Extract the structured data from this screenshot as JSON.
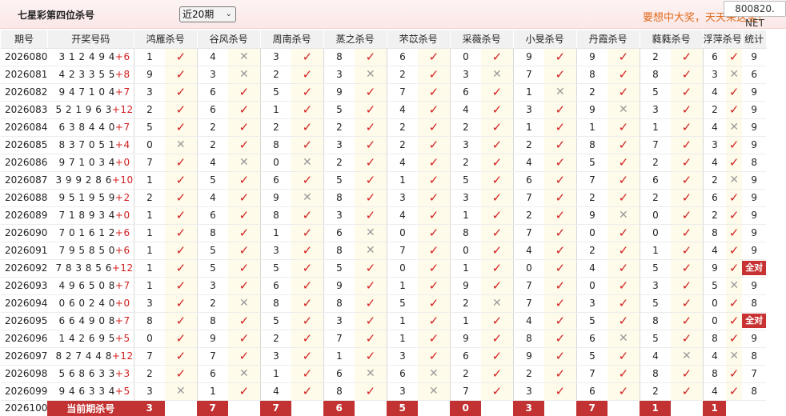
{
  "header": {
    "title": "七星彩第四位杀号",
    "period_selected": "近20期",
    "slogan": "要想中大奖，天天来这里！",
    "brand": "800820. NET"
  },
  "columns": [
    "期号",
    "开奖号码",
    "鸿雁杀号",
    "谷风杀号",
    "周南杀号",
    "蒸之杀号",
    "芣苡杀号",
    "采薇杀号",
    "小旻杀号",
    "丹霞杀号",
    "蕤蕤杀号",
    "浮萍杀号",
    "统计"
  ],
  "rows": [
    {
      "period": "2026080",
      "draw": "3 1 2 4 9 4",
      "sum": "+6",
      "picks": [
        [
          1,
          "ok"
        ],
        [
          4,
          "x"
        ],
        [
          3,
          "ok"
        ],
        [
          8,
          "ok"
        ],
        [
          6,
          "ok"
        ],
        [
          0,
          "ok"
        ],
        [
          9,
          "ok"
        ],
        [
          9,
          "ok"
        ],
        [
          2,
          "ok"
        ],
        [
          6,
          "ok"
        ]
      ],
      "stat": "9"
    },
    {
      "period": "2026081",
      "draw": "4 2 3 3 5 5",
      "sum": "+8",
      "picks": [
        [
          9,
          "ok"
        ],
        [
          3,
          "x"
        ],
        [
          2,
          "ok"
        ],
        [
          3,
          "x"
        ],
        [
          2,
          "ok"
        ],
        [
          3,
          "x"
        ],
        [
          7,
          "ok"
        ],
        [
          8,
          "ok"
        ],
        [
          8,
          "ok"
        ],
        [
          3,
          "x"
        ]
      ],
      "stat": "6"
    },
    {
      "period": "2026082",
      "draw": "9 4 7 1 0 4",
      "sum": "+7",
      "picks": [
        [
          3,
          "ok"
        ],
        [
          6,
          "ok"
        ],
        [
          5,
          "ok"
        ],
        [
          9,
          "ok"
        ],
        [
          7,
          "ok"
        ],
        [
          6,
          "ok"
        ],
        [
          1,
          "x"
        ],
        [
          2,
          "ok"
        ],
        [
          5,
          "ok"
        ],
        [
          4,
          "ok"
        ]
      ],
      "stat": "9"
    },
    {
      "period": "2026083",
      "draw": "5 2 1 9 6 3",
      "sum": "+12",
      "picks": [
        [
          2,
          "ok"
        ],
        [
          6,
          "ok"
        ],
        [
          1,
          "ok"
        ],
        [
          5,
          "ok"
        ],
        [
          4,
          "ok"
        ],
        [
          4,
          "ok"
        ],
        [
          3,
          "ok"
        ],
        [
          9,
          "x"
        ],
        [
          3,
          "ok"
        ],
        [
          2,
          "ok"
        ]
      ],
      "stat": "9"
    },
    {
      "period": "2026084",
      "draw": "6 3 8 4 4 0",
      "sum": "+7",
      "picks": [
        [
          5,
          "ok"
        ],
        [
          2,
          "ok"
        ],
        [
          2,
          "ok"
        ],
        [
          2,
          "ok"
        ],
        [
          2,
          "ok"
        ],
        [
          2,
          "ok"
        ],
        [
          1,
          "ok"
        ],
        [
          1,
          "ok"
        ],
        [
          1,
          "ok"
        ],
        [
          4,
          "x"
        ]
      ],
      "stat": "9"
    },
    {
      "period": "2026085",
      "draw": "8 3 7 0 5 1",
      "sum": "+4",
      "picks": [
        [
          0,
          "x"
        ],
        [
          2,
          "ok"
        ],
        [
          8,
          "ok"
        ],
        [
          3,
          "ok"
        ],
        [
          2,
          "ok"
        ],
        [
          3,
          "ok"
        ],
        [
          2,
          "ok"
        ],
        [
          8,
          "ok"
        ],
        [
          7,
          "ok"
        ],
        [
          3,
          "ok"
        ]
      ],
      "stat": "9"
    },
    {
      "period": "2026086",
      "draw": "9 7 1 0 3 4",
      "sum": "+0",
      "picks": [
        [
          7,
          "ok"
        ],
        [
          4,
          "x"
        ],
        [
          0,
          "x"
        ],
        [
          2,
          "ok"
        ],
        [
          4,
          "ok"
        ],
        [
          2,
          "ok"
        ],
        [
          4,
          "ok"
        ],
        [
          5,
          "ok"
        ],
        [
          2,
          "ok"
        ],
        [
          4,
          "ok"
        ]
      ],
      "stat": "8"
    },
    {
      "period": "2026087",
      "draw": "3 9 9 2 8 6",
      "sum": "+10",
      "picks": [
        [
          1,
          "ok"
        ],
        [
          5,
          "ok"
        ],
        [
          6,
          "ok"
        ],
        [
          5,
          "ok"
        ],
        [
          1,
          "ok"
        ],
        [
          5,
          "ok"
        ],
        [
          6,
          "ok"
        ],
        [
          7,
          "ok"
        ],
        [
          6,
          "ok"
        ],
        [
          2,
          "x"
        ]
      ],
      "stat": "9"
    },
    {
      "period": "2026088",
      "draw": "9 5 1 9 5 9",
      "sum": "+2",
      "picks": [
        [
          2,
          "ok"
        ],
        [
          4,
          "ok"
        ],
        [
          9,
          "x"
        ],
        [
          8,
          "ok"
        ],
        [
          3,
          "ok"
        ],
        [
          3,
          "ok"
        ],
        [
          7,
          "ok"
        ],
        [
          2,
          "ok"
        ],
        [
          2,
          "ok"
        ],
        [
          6,
          "ok"
        ]
      ],
      "stat": "9"
    },
    {
      "period": "2026089",
      "draw": "7 1 8 9 3 4",
      "sum": "+0",
      "picks": [
        [
          1,
          "ok"
        ],
        [
          6,
          "ok"
        ],
        [
          8,
          "ok"
        ],
        [
          3,
          "ok"
        ],
        [
          4,
          "ok"
        ],
        [
          1,
          "ok"
        ],
        [
          2,
          "ok"
        ],
        [
          9,
          "x"
        ],
        [
          0,
          "ok"
        ],
        [
          2,
          "ok"
        ]
      ],
      "stat": "9"
    },
    {
      "period": "2026090",
      "draw": "7 0 1 6 1 2",
      "sum": "+6",
      "picks": [
        [
          1,
          "ok"
        ],
        [
          8,
          "ok"
        ],
        [
          1,
          "ok"
        ],
        [
          6,
          "x"
        ],
        [
          0,
          "ok"
        ],
        [
          8,
          "ok"
        ],
        [
          7,
          "ok"
        ],
        [
          0,
          "ok"
        ],
        [
          0,
          "ok"
        ],
        [
          8,
          "ok"
        ]
      ],
      "stat": "9"
    },
    {
      "period": "2026091",
      "draw": "7 9 5 8 5 0",
      "sum": "+6",
      "picks": [
        [
          1,
          "ok"
        ],
        [
          5,
          "ok"
        ],
        [
          3,
          "ok"
        ],
        [
          8,
          "x"
        ],
        [
          7,
          "ok"
        ],
        [
          0,
          "ok"
        ],
        [
          4,
          "ok"
        ],
        [
          2,
          "ok"
        ],
        [
          1,
          "ok"
        ],
        [
          4,
          "ok"
        ]
      ],
      "stat": "9"
    },
    {
      "period": "2026092",
      "draw": "7 8 3 8 5 6",
      "sum": "+12",
      "picks": [
        [
          1,
          "ok"
        ],
        [
          5,
          "ok"
        ],
        [
          5,
          "ok"
        ],
        [
          5,
          "ok"
        ],
        [
          0,
          "ok"
        ],
        [
          1,
          "ok"
        ],
        [
          0,
          "ok"
        ],
        [
          4,
          "ok"
        ],
        [
          5,
          "ok"
        ],
        [
          9,
          "ok"
        ]
      ],
      "stat": "全对"
    },
    {
      "period": "2026093",
      "draw": "4 9 6 5 0 8",
      "sum": "+7",
      "picks": [
        [
          1,
          "ok"
        ],
        [
          3,
          "ok"
        ],
        [
          6,
          "ok"
        ],
        [
          9,
          "ok"
        ],
        [
          1,
          "ok"
        ],
        [
          9,
          "ok"
        ],
        [
          7,
          "ok"
        ],
        [
          0,
          "ok"
        ],
        [
          3,
          "ok"
        ],
        [
          5,
          "x"
        ]
      ],
      "stat": "9"
    },
    {
      "period": "2026094",
      "draw": "0 6 0 2 4 0",
      "sum": "+0",
      "picks": [
        [
          3,
          "ok"
        ],
        [
          2,
          "x"
        ],
        [
          8,
          "ok"
        ],
        [
          8,
          "ok"
        ],
        [
          5,
          "ok"
        ],
        [
          2,
          "x"
        ],
        [
          7,
          "ok"
        ],
        [
          3,
          "ok"
        ],
        [
          5,
          "ok"
        ],
        [
          0,
          "ok"
        ]
      ],
      "stat": "8"
    },
    {
      "period": "2026095",
      "draw": "6 6 4 9 0 8",
      "sum": "+7",
      "picks": [
        [
          8,
          "ok"
        ],
        [
          8,
          "ok"
        ],
        [
          5,
          "ok"
        ],
        [
          3,
          "ok"
        ],
        [
          1,
          "ok"
        ],
        [
          1,
          "ok"
        ],
        [
          4,
          "ok"
        ],
        [
          5,
          "ok"
        ],
        [
          8,
          "ok"
        ],
        [
          0,
          "ok"
        ]
      ],
      "stat": "全对"
    },
    {
      "period": "2026096",
      "draw": "1 4 2 6 9 5",
      "sum": "+5",
      "picks": [
        [
          0,
          "ok"
        ],
        [
          9,
          "ok"
        ],
        [
          2,
          "ok"
        ],
        [
          7,
          "ok"
        ],
        [
          1,
          "ok"
        ],
        [
          9,
          "ok"
        ],
        [
          8,
          "ok"
        ],
        [
          6,
          "x"
        ],
        [
          5,
          "ok"
        ],
        [
          8,
          "ok"
        ]
      ],
      "stat": "9"
    },
    {
      "period": "2026097",
      "draw": "8 2 7 4 4 8",
      "sum": "+12",
      "picks": [
        [
          7,
          "ok"
        ],
        [
          7,
          "ok"
        ],
        [
          3,
          "ok"
        ],
        [
          1,
          "ok"
        ],
        [
          3,
          "ok"
        ],
        [
          6,
          "ok"
        ],
        [
          9,
          "ok"
        ],
        [
          5,
          "ok"
        ],
        [
          4,
          "x"
        ],
        [
          4,
          "x"
        ]
      ],
      "stat": "8"
    },
    {
      "period": "2026098",
      "draw": "5 6 8 6 3 3",
      "sum": "+3",
      "picks": [
        [
          2,
          "ok"
        ],
        [
          6,
          "x"
        ],
        [
          1,
          "ok"
        ],
        [
          6,
          "x"
        ],
        [
          6,
          "x"
        ],
        [
          2,
          "ok"
        ],
        [
          2,
          "ok"
        ],
        [
          7,
          "ok"
        ],
        [
          8,
          "ok"
        ],
        [
          8,
          "ok"
        ]
      ],
      "stat": "7"
    },
    {
      "period": "2026099",
      "draw": "9 4 6 3 3 4",
      "sum": "+5",
      "picks": [
        [
          3,
          "x"
        ],
        [
          1,
          "ok"
        ],
        [
          4,
          "ok"
        ],
        [
          8,
          "ok"
        ],
        [
          3,
          "x"
        ],
        [
          7,
          "ok"
        ],
        [
          3,
          "ok"
        ],
        [
          6,
          "ok"
        ],
        [
          2,
          "ok"
        ],
        [
          4,
          "ok"
        ]
      ],
      "stat": "8"
    }
  ],
  "current": {
    "period": "2026100",
    "label": "当前期杀号",
    "picks": [
      "3",
      "7",
      "7",
      "6",
      "5",
      "0",
      "3",
      "7",
      "1",
      "1"
    ]
  },
  "icons": {
    "hit": "check-mark",
    "miss": "cross-mark"
  },
  "colors": {
    "accent": "#c23232",
    "hit": "#d22020",
    "miss": "#9a9a9a",
    "slogan": "#e06a1d"
  }
}
